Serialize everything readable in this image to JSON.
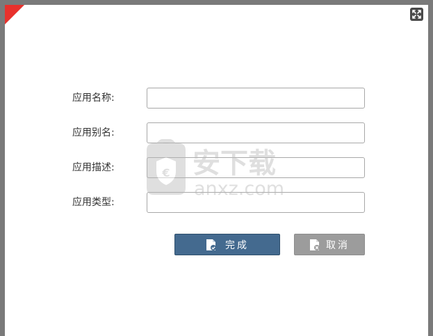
{
  "dialog": {
    "resize_icon": "expand-icon"
  },
  "form": {
    "fields": [
      {
        "label": "应用名称:",
        "value": "",
        "placeholder": ""
      },
      {
        "label": "应用别名:",
        "value": "",
        "placeholder": ""
      },
      {
        "label": "应用描述:",
        "value": "",
        "placeholder": ""
      },
      {
        "label": "应用类型:",
        "value": "",
        "placeholder": ""
      }
    ]
  },
  "actions": {
    "ok_label": "完成",
    "ok_icon": "file-check-icon",
    "cancel_label": "取消",
    "cancel_icon": "file-close-icon"
  },
  "watermark": {
    "brand": "安下载",
    "domain": "anxz.com"
  },
  "colors": {
    "accent": "#446a8f",
    "corner": "#e8312c",
    "cancel": "#9c9c9c"
  }
}
